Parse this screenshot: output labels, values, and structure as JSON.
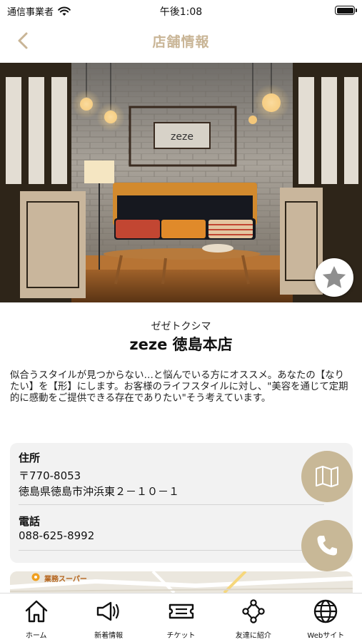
{
  "status_bar": {
    "carrier": "通信事業者",
    "time": "午後1:08",
    "battery_level": 1.0
  },
  "nav": {
    "title": "店舗情報"
  },
  "hero": {
    "sign_text": "zeze"
  },
  "shop": {
    "kana": "ゼゼトクシマ",
    "name": "zeze 徳島本店",
    "description": "似合うスタイルが見つからない…と悩んでいる方にオススメ。あなたの【なりたい】を【形】にします。お客様のライフスタイルに対し、\"美容を通じて定期的に感動をご提供できる存在でありたい\"そう考えています。"
  },
  "info": {
    "address_label": "住所",
    "postal_code": "〒770-8053",
    "address": "徳島県徳島市沖浜東２－１０－１",
    "phone_label": "電話",
    "phone": "088-625-8992"
  },
  "map": {
    "poi_label": "業務スーパー"
  },
  "tabs": [
    {
      "label": "ホーム",
      "icon": "home-icon"
    },
    {
      "label": "新着情報",
      "icon": "megaphone-icon"
    },
    {
      "label": "チケット",
      "icon": "ticket-icon"
    },
    {
      "label": "友達に紹介",
      "icon": "share-icon"
    },
    {
      "label": "Webサイト",
      "icon": "globe-icon"
    }
  ],
  "colors": {
    "accent": "#c9b596",
    "button": "#c8b897",
    "card": "#f2f2f2"
  }
}
